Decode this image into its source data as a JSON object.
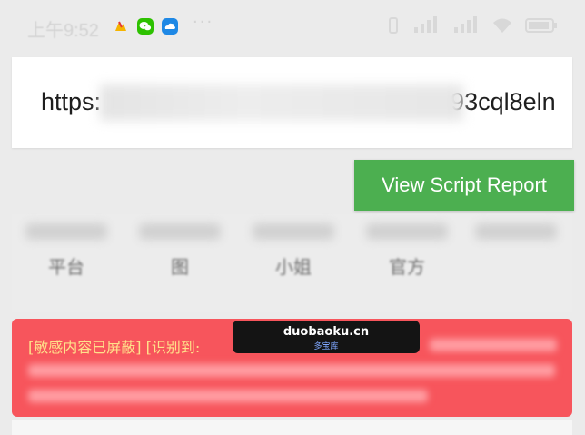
{
  "status_bar": {
    "time": "上午9:52",
    "icons": [
      "maps-icon",
      "wechat-icon",
      "cloud-icon"
    ],
    "overflow": "···",
    "right_icons": [
      "vibrate-icon",
      "signal-icon",
      "signal-icon",
      "wifi-icon",
      "battery-icon"
    ]
  },
  "url_bar": {
    "prefix": "https:",
    "suffix": "93cql8eln"
  },
  "report_button": {
    "label": "View Script Report",
    "color": "#4caf50"
  },
  "nav": {
    "items": [
      {
        "label": "平台"
      },
      {
        "label": "图"
      },
      {
        "label": "小姐"
      },
      {
        "label": "官方"
      },
      {
        "label": ""
      }
    ]
  },
  "notice": {
    "title": "[敏感内容已屏蔽] [识别到:",
    "color": "#f7555c"
  },
  "watermark": {
    "main": "duobaoku.cn",
    "sub": "多宝库"
  }
}
